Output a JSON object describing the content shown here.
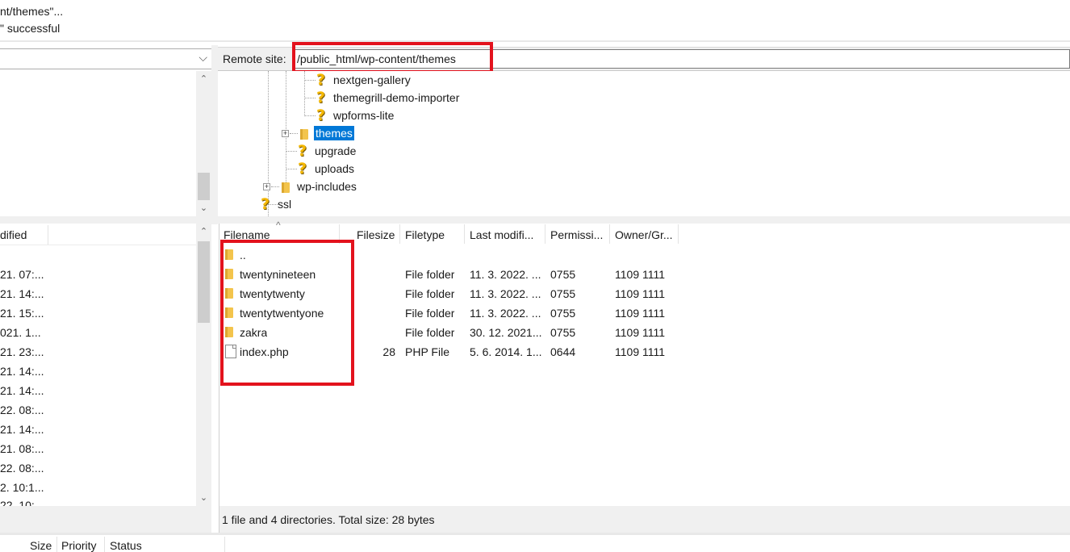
{
  "message_log": {
    "lines": [
      "nt/themes\"...",
      "\" successful"
    ]
  },
  "local_site": {
    "dropdown_arrow": "⌵"
  },
  "remote_site": {
    "label": "Remote site:",
    "path": "/public_html/wp-content/themes"
  },
  "remote_tree": {
    "items": [
      {
        "label": "nextgen-gallery",
        "icon": "question-icon"
      },
      {
        "label": "themegrill-demo-importer",
        "icon": "question-icon"
      },
      {
        "label": "wpforms-lite",
        "icon": "question-icon"
      },
      {
        "label": "themes",
        "icon": "folder-icon",
        "selected": true
      },
      {
        "label": "upgrade",
        "icon": "question-icon"
      },
      {
        "label": "uploads",
        "icon": "question-icon"
      },
      {
        "label": "wp-includes",
        "icon": "folder-icon"
      },
      {
        "label": "ssl",
        "icon": "question-icon"
      }
    ]
  },
  "local_list": {
    "header": "dified",
    "rows": [
      "21. 07:...",
      "21. 14:...",
      "21. 15:...",
      "021. 1...",
      "21. 23:...",
      "21. 14:...",
      "21. 14:...",
      "22. 08:...",
      "21. 14:...",
      "21. 08:...",
      "22. 08:...",
      "2. 10:1...",
      "22. 10:"
    ]
  },
  "remote_list": {
    "columns": {
      "filename": "Filename",
      "filesize": "Filesize",
      "filetype": "Filetype",
      "modified": "Last modifi...",
      "permissions": "Permissi...",
      "owner": "Owner/Gr..."
    },
    "sort_indicator": "^",
    "rows": [
      {
        "name": "..",
        "size": "",
        "type": "",
        "modified": "",
        "perm": "",
        "owner": "",
        "icon": "folder-icon"
      },
      {
        "name": "twentynineteen",
        "size": "",
        "type": "File folder",
        "modified": "11. 3. 2022. ...",
        "perm": "0755",
        "owner": "1109 1111",
        "icon": "folder-icon"
      },
      {
        "name": "twentytwenty",
        "size": "",
        "type": "File folder",
        "modified": "11. 3. 2022. ...",
        "perm": "0755",
        "owner": "1109 1111",
        "icon": "folder-icon"
      },
      {
        "name": "twentytwentyone",
        "size": "",
        "type": "File folder",
        "modified": "11. 3. 2022. ...",
        "perm": "0755",
        "owner": "1109 1111",
        "icon": "folder-icon"
      },
      {
        "name": "zakra",
        "size": "",
        "type": "File folder",
        "modified": "30. 12. 2021...",
        "perm": "0755",
        "owner": "1109 1111",
        "icon": "folder-icon"
      },
      {
        "name": "index.php",
        "size": "28",
        "type": "PHP File",
        "modified": "5. 6. 2014. 1...",
        "perm": "0644",
        "owner": "1109 1111",
        "icon": "file-icon"
      }
    ],
    "status": "1 file and 4 directories. Total size: 28 bytes"
  },
  "queue": {
    "columns": {
      "size": "Size",
      "priority": "Priority",
      "status": "Status"
    }
  },
  "colors": {
    "highlight": "#e3121d",
    "selection": "#0078d7",
    "folder": "#f3c44c"
  }
}
